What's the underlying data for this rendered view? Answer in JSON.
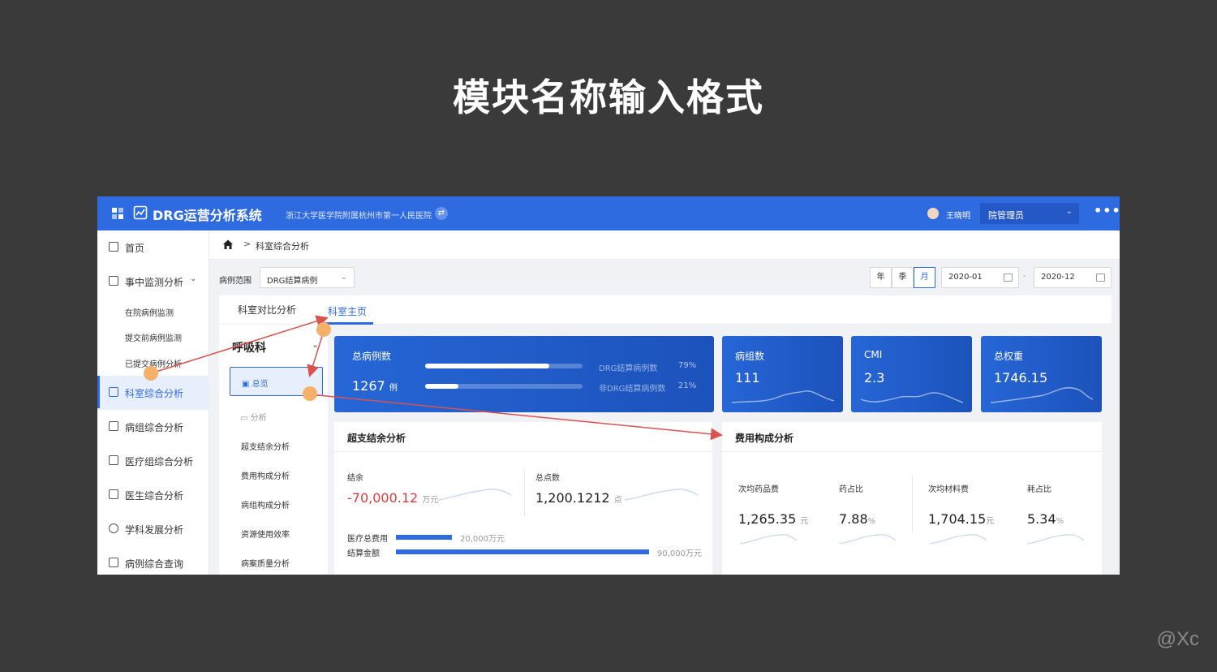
{
  "slide": {
    "title": "模块名称输入格式",
    "watermark": "@Xc"
  },
  "header": {
    "app_name": "DRG运营分析系统",
    "hospital": "浙江大学医学院附属杭州市第一人民医院",
    "user_name": "王晓明",
    "role": "院管理员",
    "more": "•••"
  },
  "sidebar": {
    "items": [
      {
        "label": "首页"
      },
      {
        "label": "事中监测分析"
      },
      {
        "label": "科室综合分析"
      },
      {
        "label": "病组综合分析"
      },
      {
        "label": "医疗组综合分析"
      },
      {
        "label": "医生综合分析"
      },
      {
        "label": "学科发展分析"
      },
      {
        "label": "病例综合查询"
      }
    ],
    "subitems": [
      {
        "label": "在院病例监测"
      },
      {
        "label": "提交前病例监测"
      },
      {
        "label": "已提交病例分析"
      }
    ]
  },
  "breadcrumb": {
    "sep": ">",
    "current": "科室综合分析"
  },
  "filters": {
    "scope_label": "病例范围",
    "scope_value": "DRG结算病例",
    "periods": [
      "年",
      "季",
      "月"
    ],
    "active_period": "月",
    "date_start": "2020-01",
    "date_dash": "-",
    "date_end": "2020-12"
  },
  "tabs": [
    {
      "label": "科室对比分析"
    },
    {
      "label": "科室主页"
    }
  ],
  "active_tab": "科室主页",
  "left_panel": {
    "department": "呼吸科",
    "overview": "总览",
    "analysis": "分析",
    "links": [
      "超支结余分析",
      "费用构成分析",
      "病组构成分析",
      "资源使用效率",
      "病案质量分析"
    ]
  },
  "kpi_main": {
    "title": "总病例数",
    "value": "1267",
    "unit": "例",
    "bars": [
      {
        "label": "DRG结算病例数",
        "pct": "79%",
        "fraction": 0.79
      },
      {
        "label": "非DRG结算病例数",
        "pct": "21%",
        "fraction": 0.21
      }
    ]
  },
  "kpi_cards": [
    {
      "title": "病组数",
      "value": "111"
    },
    {
      "title": "CMI",
      "value": "2.3"
    },
    {
      "title": "总权重",
      "value": "1746.15"
    }
  ],
  "overrun_card": {
    "title": "超支结余分析",
    "balance_label": "结余",
    "balance_value": "-70,000.12",
    "balance_unit": "万元",
    "points_label": "总点数",
    "points_value": "1,200.1212",
    "points_unit": "点",
    "bars": [
      {
        "label": "医疗总费用",
        "value": "20,000万元",
        "amount": 20000
      },
      {
        "label": "结算金额",
        "value": "90,000万元",
        "amount": 90000
      }
    ]
  },
  "cost_card": {
    "title": "费用构成分析",
    "metrics": [
      {
        "label": "次均药品费",
        "value": "1,265.35",
        "unit": "元"
      },
      {
        "label": "药占比",
        "value": "7.88",
        "unit": "%"
      },
      {
        "label": "次均材料费",
        "value": "1,704.15",
        "unit": "元"
      },
      {
        "label": "耗占比",
        "value": "5.34",
        "unit": "%"
      }
    ]
  },
  "colors": {
    "primary": "#2f6be0",
    "kpi": "#2666d6",
    "negative": "#e23b3b",
    "annotation": "#d9534f",
    "marker": "#f5b06a"
  }
}
